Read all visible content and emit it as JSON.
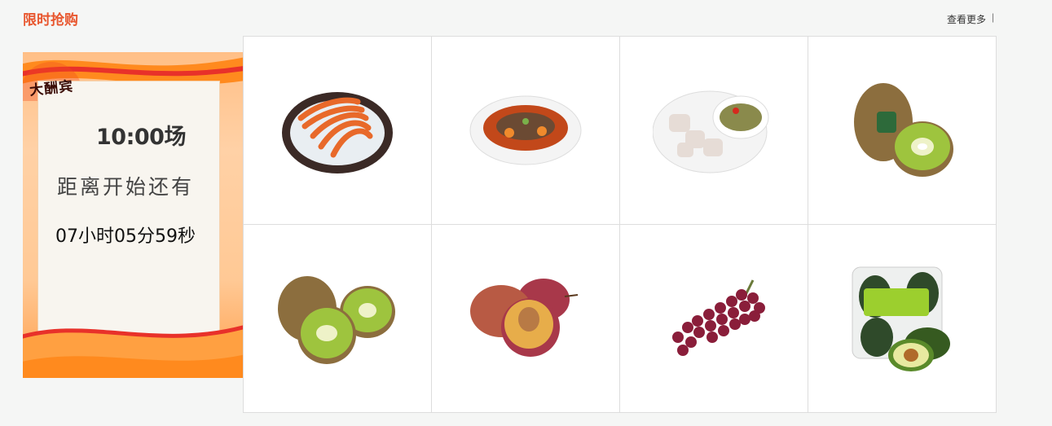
{
  "section": {
    "title": "限时抢购"
  },
  "header": {
    "more_label": "查看更多",
    "separator": "|"
  },
  "banner": {
    "logo_text": "大酬宾",
    "session": "10:00场",
    "until_label": "距离开始还有",
    "countdown": "07小时05分59秒"
  },
  "products": [
    {
      "icon": "shrimp-platter-image"
    },
    {
      "icon": "stew-bowl-image"
    },
    {
      "icon": "fish-and-sauce-plate-image"
    },
    {
      "icon": "kiwi-with-label-image"
    },
    {
      "icon": "kiwi-fruits-image"
    },
    {
      "icon": "plums-image"
    },
    {
      "icon": "grapes-image"
    },
    {
      "icon": "avocado-pack-image"
    }
  ],
  "colors": {
    "accent": "#e8572f",
    "border": "#dddddd",
    "banner_orange": "#ff9e4a"
  }
}
